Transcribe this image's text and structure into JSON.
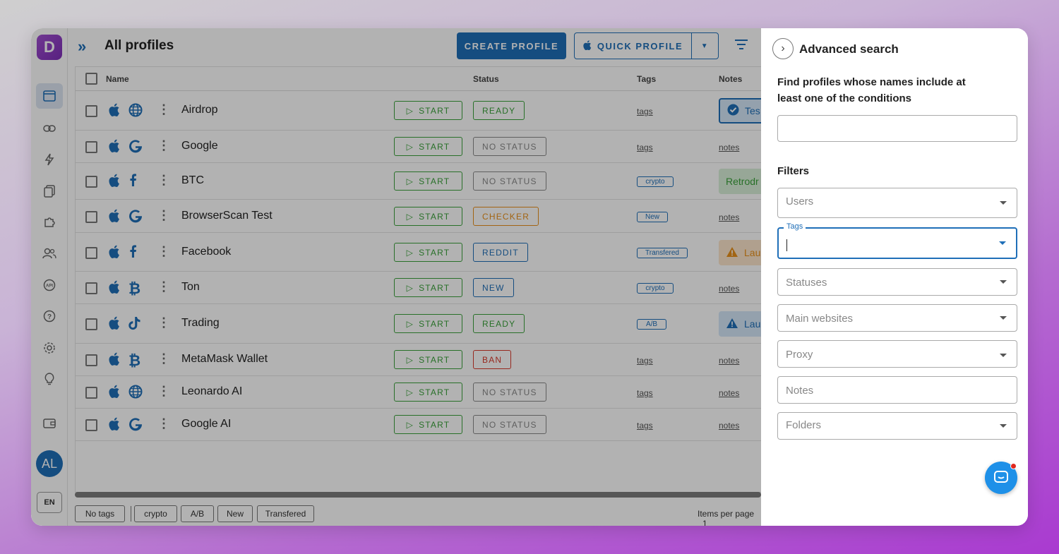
{
  "app": {
    "logo_letter": "D",
    "avatar_initials": "AL",
    "language": "EN",
    "page_title": "All profiles"
  },
  "toolbar": {
    "create_label": "CREATE PROFILE",
    "quick_label": "QUICK PROFILE"
  },
  "table": {
    "headers": {
      "name": "Name",
      "status": "Status",
      "tags": "Tags",
      "notes": "Notes"
    },
    "rows": [
      {
        "name": "Airdrop",
        "site_icon": "globe-icon",
        "start": "START",
        "status": "READY",
        "status_color": "#3aa13a",
        "tags": "tags",
        "tag_chip": false,
        "notes": "Tes",
        "note_chip": "check",
        "note_color": "#1f6fb8"
      },
      {
        "name": "Google",
        "site_icon": "google-icon",
        "start": "START",
        "status": "NO STATUS",
        "status_color": "#888888",
        "tags": "tags",
        "tag_chip": false,
        "notes": "notes",
        "note_chip": null,
        "note_color": ""
      },
      {
        "name": "BTC",
        "site_icon": "facebook-icon",
        "start": "START",
        "status": "NO STATUS",
        "status_color": "#888888",
        "tags": "crypto",
        "tag_chip": true,
        "notes": "Retrodr",
        "note_chip": "plain",
        "note_color": "#3aa13a"
      },
      {
        "name": "BrowserScan Test",
        "site_icon": "google-icon",
        "start": "START",
        "status": "CHECKER",
        "status_color": "#e8901a",
        "tags": "New",
        "tag_chip": true,
        "notes": "notes",
        "note_chip": null,
        "note_color": ""
      },
      {
        "name": "Facebook",
        "site_icon": "facebook-icon",
        "start": "START",
        "status": "REDDIT",
        "status_color": "#1f6fb8",
        "tags": "Transfered",
        "tag_chip": true,
        "notes": "Lau",
        "note_chip": "warn",
        "note_color": "#e8901a"
      },
      {
        "name": "Ton",
        "site_icon": "bitcoin-icon",
        "start": "START",
        "status": "NEW",
        "status_color": "#1f6fb8",
        "tags": "crypto",
        "tag_chip": true,
        "notes": "notes",
        "note_chip": null,
        "note_color": ""
      },
      {
        "name": "Trading",
        "site_icon": "tiktok-icon",
        "start": "START",
        "status": "READY",
        "status_color": "#3aa13a",
        "tags": "A/B",
        "tag_chip": true,
        "notes": "Lau",
        "note_chip": "warn",
        "note_color": "#1f6fb8"
      },
      {
        "name": "MetaMask Wallet",
        "site_icon": "bitcoin-icon",
        "start": "START",
        "status": "BAN",
        "status_color": "#d93a2b",
        "tags": "tags",
        "tag_chip": false,
        "notes": "notes",
        "note_chip": null,
        "note_color": ""
      },
      {
        "name": "Leonardo AI",
        "site_icon": "globe-icon",
        "start": "START",
        "status": "NO STATUS",
        "status_color": "#888888",
        "tags": "tags",
        "tag_chip": false,
        "notes": "notes",
        "note_chip": null,
        "note_color": ""
      },
      {
        "name": "Google AI",
        "site_icon": "google-icon",
        "start": "START",
        "status": "NO STATUS",
        "status_color": "#888888",
        "tags": "tags",
        "tag_chip": false,
        "notes": "notes",
        "note_chip": null,
        "note_color": ""
      }
    ]
  },
  "footer": {
    "tag_filters": [
      "No tags",
      "crypto",
      "A/B",
      "New",
      "Transfered"
    ],
    "items_per_page_label": "Items per page",
    "items_per_page_value": "1"
  },
  "panel": {
    "title": "Advanced search",
    "description": "Find profiles whose names include at least one of the conditions",
    "search_value": "",
    "filters_label": "Filters",
    "fields": {
      "users": "Users",
      "tags_label": "Tags",
      "statuses": "Statuses",
      "main_websites": "Main websites",
      "proxy": "Proxy",
      "notes": "Notes",
      "folders": "Folders"
    }
  },
  "colors": {
    "accent": "#1f6fb8",
    "ready": "#3aa13a",
    "checker": "#e8901a",
    "ban": "#d93a2b"
  }
}
